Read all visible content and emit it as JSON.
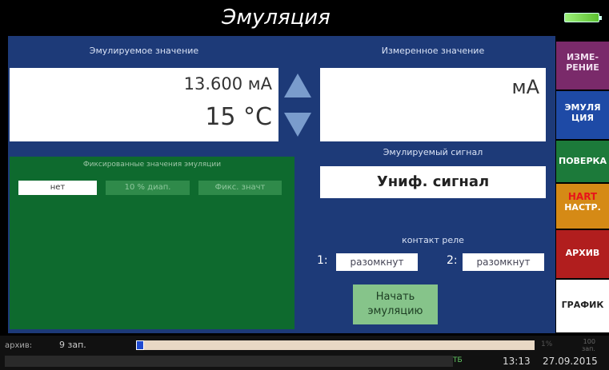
{
  "header": {
    "title": "Эмуляция"
  },
  "emulated": {
    "label": "Эмулируемое значение",
    "value_current": "13.600 мА",
    "value_temp": "15 °C"
  },
  "measured": {
    "label": "Измеренное значение",
    "unit": "мА"
  },
  "fixed": {
    "label": "Фиксированные значения эмуляции",
    "btn_none": "нет",
    "btn_10pct": "10 % диап.",
    "btn_fixed": "Фикс. значт"
  },
  "signal": {
    "label": "Эмулируемый сигнал",
    "value": "Униф. сигнал"
  },
  "relay": {
    "label": "контакт реле",
    "n1": "1:",
    "state1": "разомкнут",
    "n2": "2:",
    "state2": "разомкнут"
  },
  "start": {
    "line1": "Начать",
    "line2": "эмуляцию"
  },
  "side": {
    "measure_1": "ИЗМЕ-",
    "measure_2": "РЕНИЕ",
    "emul_1": "ЭМУЛЯ",
    "emul_2": "ЦИЯ",
    "verify": "ПОВЕРКА",
    "hart": "HART",
    "settings": "НАСТР.",
    "archive": "АРХИВ",
    "graph": "ГРАФИК"
  },
  "footer": {
    "archive_label": "архив:",
    "archive_time": "9 зап.",
    "progress_fraction": 0.02,
    "tail": "1%",
    "tiny_1": "100",
    "tiny_2": "зап.",
    "tb": "ТБ",
    "time": "13:13",
    "date": "27.09.2015"
  },
  "colors": {
    "panel_blue": "#1d3a78",
    "green_panel": "#0e6a2e",
    "accent_arrows": "#7a9ccc",
    "start_button": "#86c48a"
  }
}
